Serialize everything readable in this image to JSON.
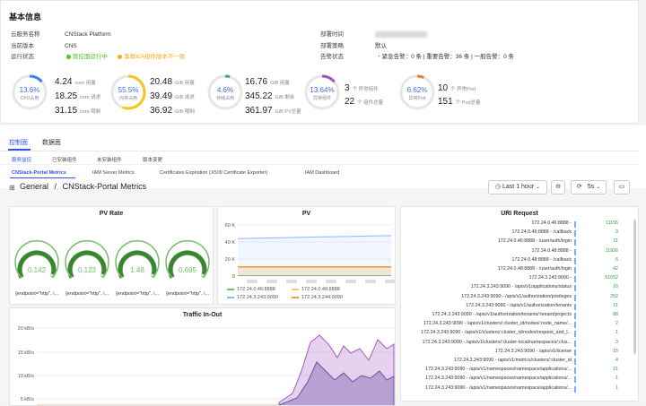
{
  "info": {
    "title": "基本信息",
    "rows": [
      {
        "key": "云服务名称",
        "value": "CNStack Platform"
      },
      {
        "key": "当前版本",
        "value": "CNS"
      },
      {
        "key": "运行状态",
        "status1": "管控面运行中",
        "status2": "集群tcA组件版本不一致"
      }
    ],
    "right_rows": [
      {
        "key": "部署时间",
        "value": ""
      },
      {
        "key": "部署策略",
        "value": "默认"
      },
      {
        "key": "告警状态",
        "alerts": "紧急告警：0 条 | 重要告警：36 条 | 一般告警：0 条"
      }
    ],
    "gauges": [
      {
        "value": "13.6%",
        "label": "CPU占用",
        "fraction": 0.136,
        "color": "#3b82f6"
      },
      {
        "value": "55.5%",
        "label": "内存占用",
        "fraction": 0.555,
        "color": "#f5c518"
      },
      {
        "value": "4.6%",
        "label": "存储占用",
        "fraction": 0.046,
        "color": "#3bb273"
      },
      {
        "value": "13.64%",
        "label": "异常组件",
        "fraction": 0.1364,
        "color": "#9b59b6"
      },
      {
        "value": "6.62%",
        "label": "异常Pod",
        "fraction": 0.0662,
        "color": "#e67e22"
      }
    ],
    "stats": [
      [
        {
          "v": "4.24",
          "u": "core 用量"
        },
        {
          "v": "18.25",
          "u": "core 请求"
        },
        {
          "v": "31.15",
          "u": "core 限制"
        }
      ],
      [
        {
          "v": "20.48",
          "u": "GiB 用量"
        },
        {
          "v": "39.49",
          "u": "GiB 请求"
        },
        {
          "v": "36.92",
          "u": "GiB 限制"
        }
      ],
      [
        {
          "v": "16.76",
          "u": "GiB 用量"
        },
        {
          "v": "345.22",
          "u": "GiB 剩余"
        },
        {
          "v": "361.97",
          "u": "GiB PV总量"
        }
      ],
      [
        {
          "v": "3",
          "u": "个 异常组件"
        },
        {
          "v": "22",
          "u": "个 组件总量"
        }
      ],
      [
        {
          "v": "10",
          "u": "个 异常Pod"
        },
        {
          "v": "151",
          "u": "个 Pod总量"
        }
      ]
    ]
  },
  "tabs": {
    "primary": [
      "控制面",
      "数据面"
    ],
    "secondary": [
      "服务监控",
      "已安装组件",
      "未安装组件",
      "版本变更"
    ],
    "tertiary": [
      "CNStack-Portal Metrics",
      "IAM Server Metrics",
      "Certificates Expiration (X509 Certificate Exporter)",
      "IAM Dashboard"
    ]
  },
  "dashboard": {
    "breadcrumb_root": "General",
    "breadcrumb_sep": "/",
    "breadcrumb_page": "CNStack-Portal Metrics",
    "time_range": "Last 1 hour",
    "refresh": "5s"
  },
  "pv_rate": {
    "title": "PV Rate",
    "gauges": [
      {
        "value": "0.142",
        "label": "{endpoint=\"http\", i...",
        "fraction": 0.95
      },
      {
        "value": "0.123",
        "label": "{endpoint=\"http\", i...",
        "fraction": 0.95
      },
      {
        "value": "1.48",
        "label": "{endpoint=\"http\", i...",
        "fraction": 0.95
      },
      {
        "value": "0.695",
        "label": "{endpoint=\"http\", i...",
        "fraction": 0.95
      }
    ]
  },
  "traffic": {
    "title": "Traffic In-Out",
    "yticks": [
      "20 kB/s",
      "15 kB/s",
      "10 kB/s",
      "5 kB/s"
    ]
  },
  "chart_data": {
    "type": "line",
    "title": "PV",
    "ylim": [
      0,
      60000
    ],
    "yticks": [
      "60 K",
      "40 K",
      "20 K",
      "0"
    ],
    "series": [
      {
        "name": "172.24.0.46:8888",
        "color": "#73bf69",
        "values": [
          500,
          500,
          500,
          500,
          500,
          500,
          500,
          500
        ]
      },
      {
        "name": "172.24.0.48:8888",
        "color": "#f2c96d",
        "values": [
          10000,
          10000,
          10000,
          10000,
          10000,
          10000,
          10000,
          10000
        ]
      },
      {
        "name": "172.24.3.243:9090",
        "color": "#8ab8ff",
        "values": [
          44000,
          44500,
          45000,
          45500,
          46000,
          46500,
          47000,
          47500
        ]
      },
      {
        "name": "172.24.3.244:9090",
        "color": "#ff9830",
        "values": [
          11000,
          11000,
          11000,
          11000,
          11000,
          11000,
          11000,
          11000
        ]
      }
    ],
    "grid": true,
    "legend": "bottom"
  },
  "uri": {
    "title": "URI Request",
    "rows": [
      {
        "label": "172.24.0.46:8888 -",
        "value": "11156"
      },
      {
        "label": "172.24.0.46:8888 - /callback",
        "value": "9"
      },
      {
        "label": "172.24.0.46:8888 - /user/auth/login",
        "value": "31"
      },
      {
        "label": "172.24.0.48:8888 -",
        "value": "11926"
      },
      {
        "label": "172.24.0.48:8888 - /callback",
        "value": "6"
      },
      {
        "label": "172.24.0.48:8888 - /user/auth/login",
        "value": "42"
      },
      {
        "label": "172.24.3.243:9090 -",
        "value": "51052"
      },
      {
        "label": "172.24.3.243:9090 - /apis/v1/applications/status",
        "value": "10"
      },
      {
        "label": "172.24.3.243:9090 - /apis/v1/authorization/privileges",
        "value": "252"
      },
      {
        "label": "172.24.3.243:9090 - /apis/v1/authorization/tenants",
        "value": "21"
      },
      {
        "label": "172.24.3.243:9090 - /apis/v1/authorization/tenants/:tenant/projects",
        "value": "88"
      },
      {
        "label": "172.24.3.243:9090 - /apis/v1/clusters/:cluster_id/nodes/:node_name/...",
        "value": "2"
      },
      {
        "label": "172.24.3.243:9090 - /apis/v1/clusters/:cluster_id/nodes/request_and_l...",
        "value": "1"
      },
      {
        "label": "172.24.3.243:9090 - /apis/v1/clusters/:cluster-local/namespaces/:clus...",
        "value": "3"
      },
      {
        "label": "172.24.3.243:9090 - /apis/v1/license",
        "value": "15"
      },
      {
        "label": "172.24.3.243:9090 - /apis/v1/metrics/clusters/:cluster_id",
        "value": "4"
      },
      {
        "label": "172.24.3.243:9090 - /apis/v1/namespaces/namespace/applications/...",
        "value": "21"
      },
      {
        "label": "172.24.3.243:9090 - /apis/v1/namespaces/namespace/applications/...",
        "value": "1"
      },
      {
        "label": "172.24.3.243:9090 - /apis/v1/namespaces/namespace/applications/...",
        "value": "1"
      }
    ]
  }
}
